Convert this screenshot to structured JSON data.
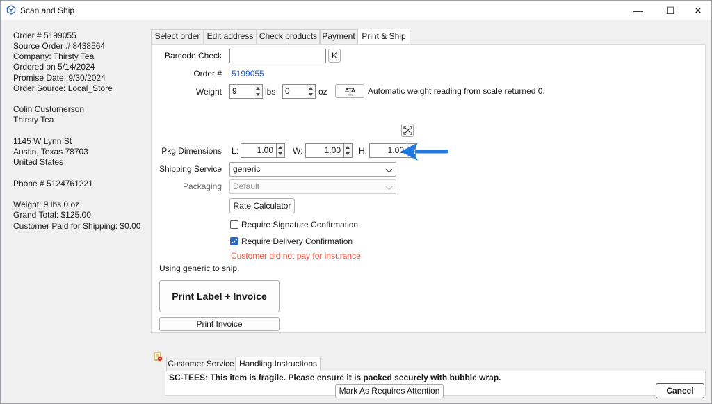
{
  "window": {
    "title": "Scan and Ship",
    "minimize": "—",
    "maximize": "☐",
    "close": "✕"
  },
  "order_info": {
    "order": "Order # 5199055",
    "source_order": "Source Order # 8438564",
    "company": "Company: Thirsty Tea",
    "ordered_on": "Ordered on 5/14/2024",
    "promise_date": "Promise Date: 9/30/2024",
    "order_source": "Order Source: Local_Store",
    "customer_name": "Colin Customerson",
    "customer_company": "Thirsty Tea",
    "address1": "1145 W Lynn St",
    "address2": "Austin, Texas 78703",
    "country": "United States",
    "phone": "Phone # 5124761221",
    "weight": "Weight: 9 lbs 0 oz",
    "grand_total": "Grand Total: $125.00",
    "shipping_paid": "Customer Paid for Shipping: $0.00"
  },
  "tabs": [
    {
      "label": "Select order"
    },
    {
      "label": "Edit address"
    },
    {
      "label": "Check products"
    },
    {
      "label": "Payment"
    },
    {
      "label": "Print & Ship",
      "active": true
    }
  ],
  "form": {
    "barcode_label": "Barcode Check",
    "barcode_value": "",
    "k_button": "K",
    "order_label": "Order #",
    "order_value": "5199055",
    "weight_label": "Weight",
    "weight_lbs": "9",
    "lbs_unit": "lbs",
    "weight_oz": "0",
    "oz_unit": "oz",
    "scale_message": "Automatic weight reading from scale returned 0.",
    "pkg_label": "Pkg Dimensions",
    "l_label": "L:",
    "l_value": "1.00",
    "w_label": "W:",
    "w_value": "1.00",
    "h_label": "H:",
    "h_value": "1.00",
    "service_label": "Shipping Service",
    "service_value": "generic",
    "packaging_label": "Packaging",
    "packaging_value": "Default",
    "rate_button": "Rate Calculator",
    "signature_label": "Require Signature Confirmation",
    "signature_checked": false,
    "delivery_label": "Require Delivery Confirmation",
    "delivery_checked": true,
    "insurance_warning": "Customer did not pay for insurance",
    "using_text": "Using generic to ship.",
    "print_label_button": "Print Label + Invoice",
    "print_invoice_button": "Print Invoice"
  },
  "bottom_tabs": [
    {
      "label": "Customer Service"
    },
    {
      "label": "Handling Instructions",
      "active": true
    }
  ],
  "handling_note": "SC-TEES: This item is fragile. Please ensure it is packed securely with bubble wrap.",
  "footer": {
    "attention_button": "Mark As Requires Attention",
    "cancel_button": "Cancel"
  },
  "colors": {
    "link": "#1a57c8",
    "warning": "#e8503a",
    "arrow": "#1f7ae0",
    "check": "#2b67c6"
  }
}
